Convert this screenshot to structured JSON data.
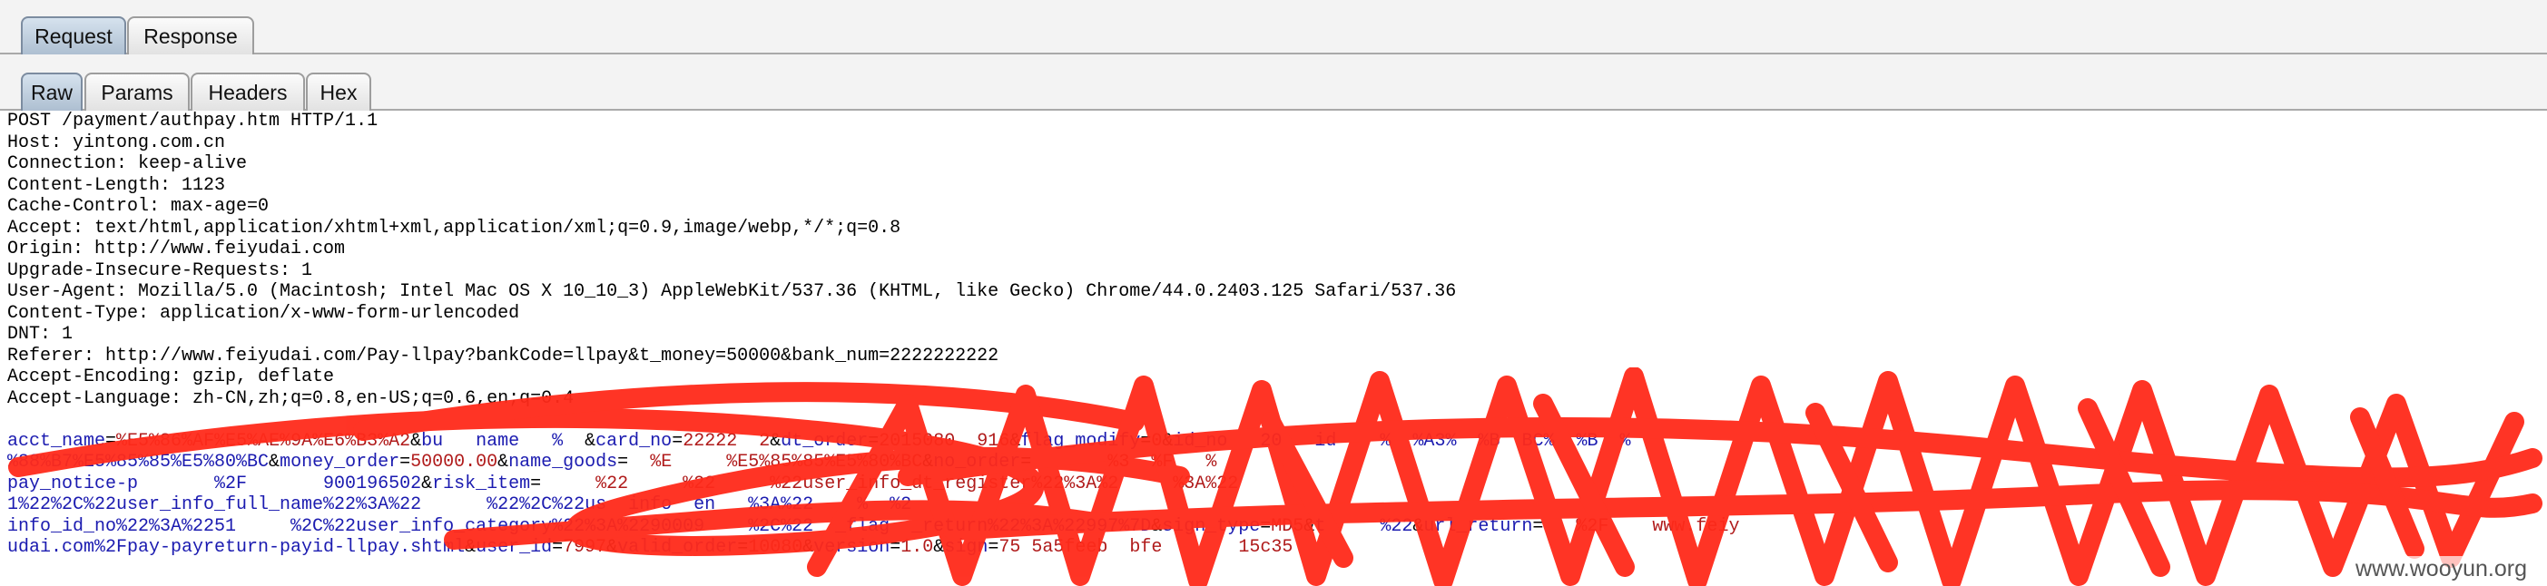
{
  "top_tabs": [
    {
      "label": "Request",
      "active": true
    },
    {
      "label": "Response",
      "active": false
    }
  ],
  "sub_tabs": [
    {
      "label": "Raw",
      "active": true
    },
    {
      "label": "Params",
      "active": false
    },
    {
      "label": "Headers",
      "active": false
    },
    {
      "label": "Hex",
      "active": false
    }
  ],
  "request": {
    "headers": [
      "POST /payment/authpay.htm HTTP/1.1",
      "Host: yintong.com.cn",
      "Connection: keep-alive",
      "Content-Length: 1123",
      "Cache-Control: max-age=0",
      "Accept: text/html,application/xhtml+xml,application/xml;q=0.9,image/webp,*/*;q=0.8",
      "Origin: http://www.feiyudai.com",
      "Upgrade-Insecure-Requests: 1",
      "User-Agent: Mozilla/5.0 (Macintosh; Intel Mac OS X 10_10_3) AppleWebKit/537.36 (KHTML, like Gecko) Chrome/44.0.2403.125 Safari/537.36",
      "Content-Type: application/x-www-form-urlencoded",
      "DNT: 1",
      "Referer: http://www.feiyudai.com/Pay-llpay?bankCode=llpay&t_money=50000&bank_num=2222222222",
      "Accept-Encoding: gzip, deflate",
      "Accept-Language: zh-CN,zh;q=0.8,en-US;q=0.6,en;q=0.4"
    ],
    "body_lines": [
      "acct_name=%E5%86%AF%E5%AE%9A%E6%B3%A2&bu   name   %  &card_no=22222  2&dt_order=2015080  916&flag_modify=0&id_no   20   id    %  %A3%  %B  BC%  %B  %",
      "%88%B7%E5%85%85%E5%80%BC&money_order=50000.00&name_goods=  %E     %E5%85%85%E5%80%BC&no_order=       %3  %F   %",
      "pay_notice-p       %2F       900196502&risk_item=     %22     %22     %22user_info_dt_register%22%3A%2     %3A%22",
      "1%22%2C%22user_info_full_name%22%3A%22      %22%2C%22us  info  en   %3A%22    %  %2",
      "info_id_no%22%3A%2251     %2C%22user_info_category%22%3A%2290009    %2C%22  _flag  _return%22%3A%22997%7D&sign_type=MD5&t     %22&url_return=   %2F    www.feiy",
      "udai.com%2Fpay-payreturn-payid-llpay.shtml&user_id=7997&valid_order=10080&version=1.0&sign=75 5a5feeb  bfe       15c35"
    ]
  },
  "watermark": "www.wooyun.org",
  "colors": {
    "tab_active": "#b9c9da",
    "param_key": "#1b1bb0",
    "param_value": "#b01b1b",
    "scribble": "#ff2a1a"
  }
}
